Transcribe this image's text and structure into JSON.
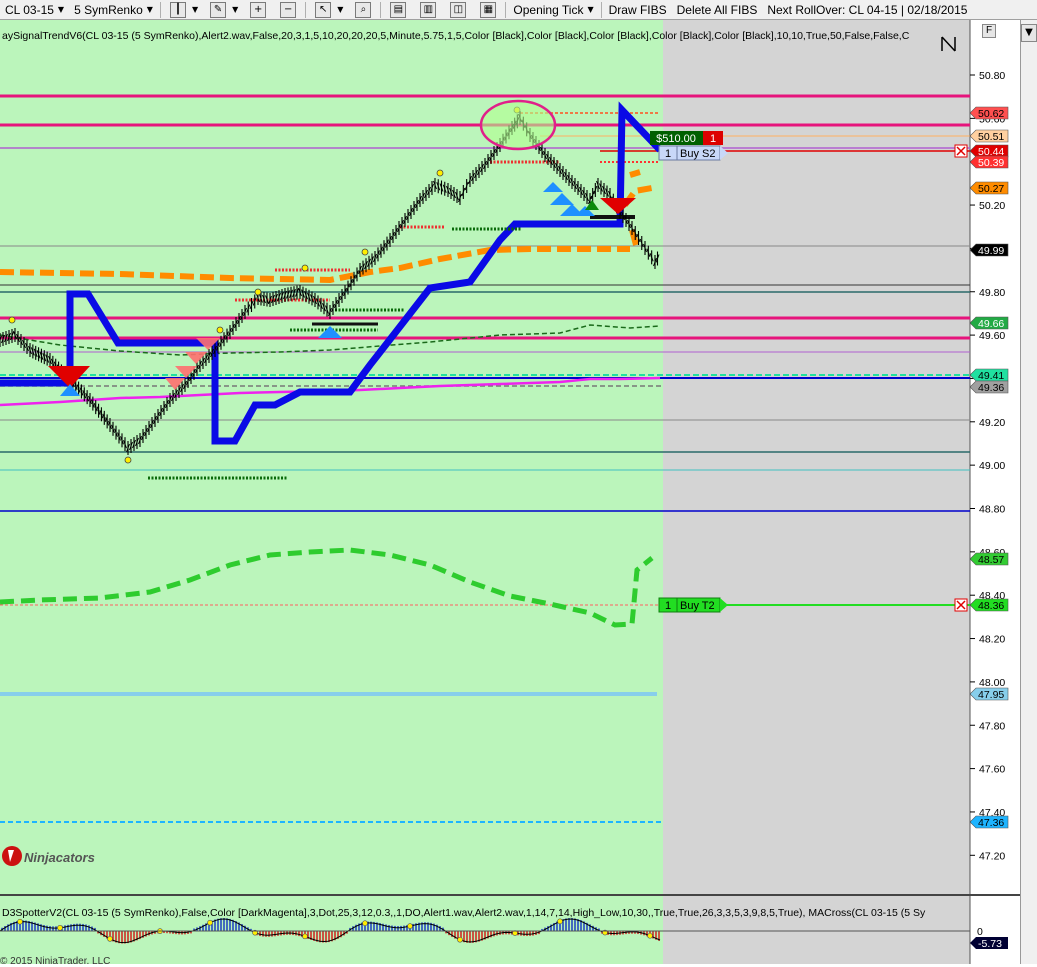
{
  "toolbar": {
    "instrument": "CL 03-15",
    "bar_type": "5 SymRenko",
    "order_type": "Opening Tick",
    "draw_fibs": "Draw FIBS",
    "delete_fibs": "Delete All FIBS",
    "rollover": "Next RollOver:  CL 04-15 | 02/18/2015"
  },
  "chart": {
    "indicator_label": "aySignalTrendV6(CL 03-15 (5 SymRenko),Alert2.wav,False,20,3,1,5,10,20,20,20,5,Minute,5.75,1,5,Color [Black],Color [Black],Color [Black],Color [Black],Color [Black],10,10,True,50,False,False,C",
    "lower_label": "D3SpotterV2(CL 03-15 (5 SymRenko),False,Color [DarkMagenta],3,Dot,25,3,12,0.3,,1,DO,Alert1.wav,Alert2.wav,1,14,7,14,High_Low,10,30,,True,True,26,3,3,5,3,9,8,5,True), MACross(CL 03-15 (5 Sy",
    "watermark": "Ninjacators",
    "copyright": "© 2015 NinjaTrader, LLC",
    "position_pnl": "$510.00",
    "position_qty": "1",
    "buy_s2_qty": "1",
    "buy_s2_label": "Buy S2",
    "buy_t2_qty": "1",
    "buy_t2_label": "Buy T2",
    "f_button": "F",
    "colors": {
      "session_bg": "#bbf5bb",
      "future_bg": "#d4d4d4",
      "trend": "#0a0ae6",
      "magenta_line": "#e6147c",
      "orange_dash": "#ff8c00",
      "green_dash": "#2ecc2e"
    }
  },
  "price_axis": {
    "ticks": [
      "50.80",
      "50.60",
      "50.40",
      "50.20",
      "50.00",
      "49.80",
      "49.60",
      "49.40",
      "49.20",
      "49.00",
      "48.80",
      "48.60",
      "48.40",
      "48.20",
      "48.00",
      "47.80",
      "47.60",
      "47.40",
      "47.20"
    ],
    "flags": [
      {
        "text": "50.62",
        "bg": "#ff5050",
        "fg": "#000"
      },
      {
        "text": "50.51",
        "bg": "#ffd0a0",
        "fg": "#000"
      },
      {
        "text": "50.44",
        "bg": "#e00000",
        "fg": "#fff"
      },
      {
        "text": "50.39",
        "bg": "#ff3030",
        "fg": "#fff"
      },
      {
        "text": "50.27",
        "bg": "#ff8c00",
        "fg": "#000"
      },
      {
        "text": "49.99",
        "bg": "#000000",
        "fg": "#fff"
      },
      {
        "text": "49.66",
        "bg": "#22aa44",
        "fg": "#fff"
      },
      {
        "text": "49.41",
        "bg": "#20e0a0",
        "fg": "#000"
      },
      {
        "text": "49.36",
        "bg": "#a0a0a0",
        "fg": "#000"
      },
      {
        "text": "48.57",
        "bg": "#33cc33",
        "fg": "#000"
      },
      {
        "text": "48.36",
        "bg": "#22dd22",
        "fg": "#000"
      },
      {
        "text": "47.95",
        "bg": "#87ceeb",
        "fg": "#000"
      },
      {
        "text": "47.36",
        "bg": "#1eb4ff",
        "fg": "#000"
      }
    ],
    "lower_ticks": [
      "0"
    ],
    "lower_flag": "-5.73"
  }
}
